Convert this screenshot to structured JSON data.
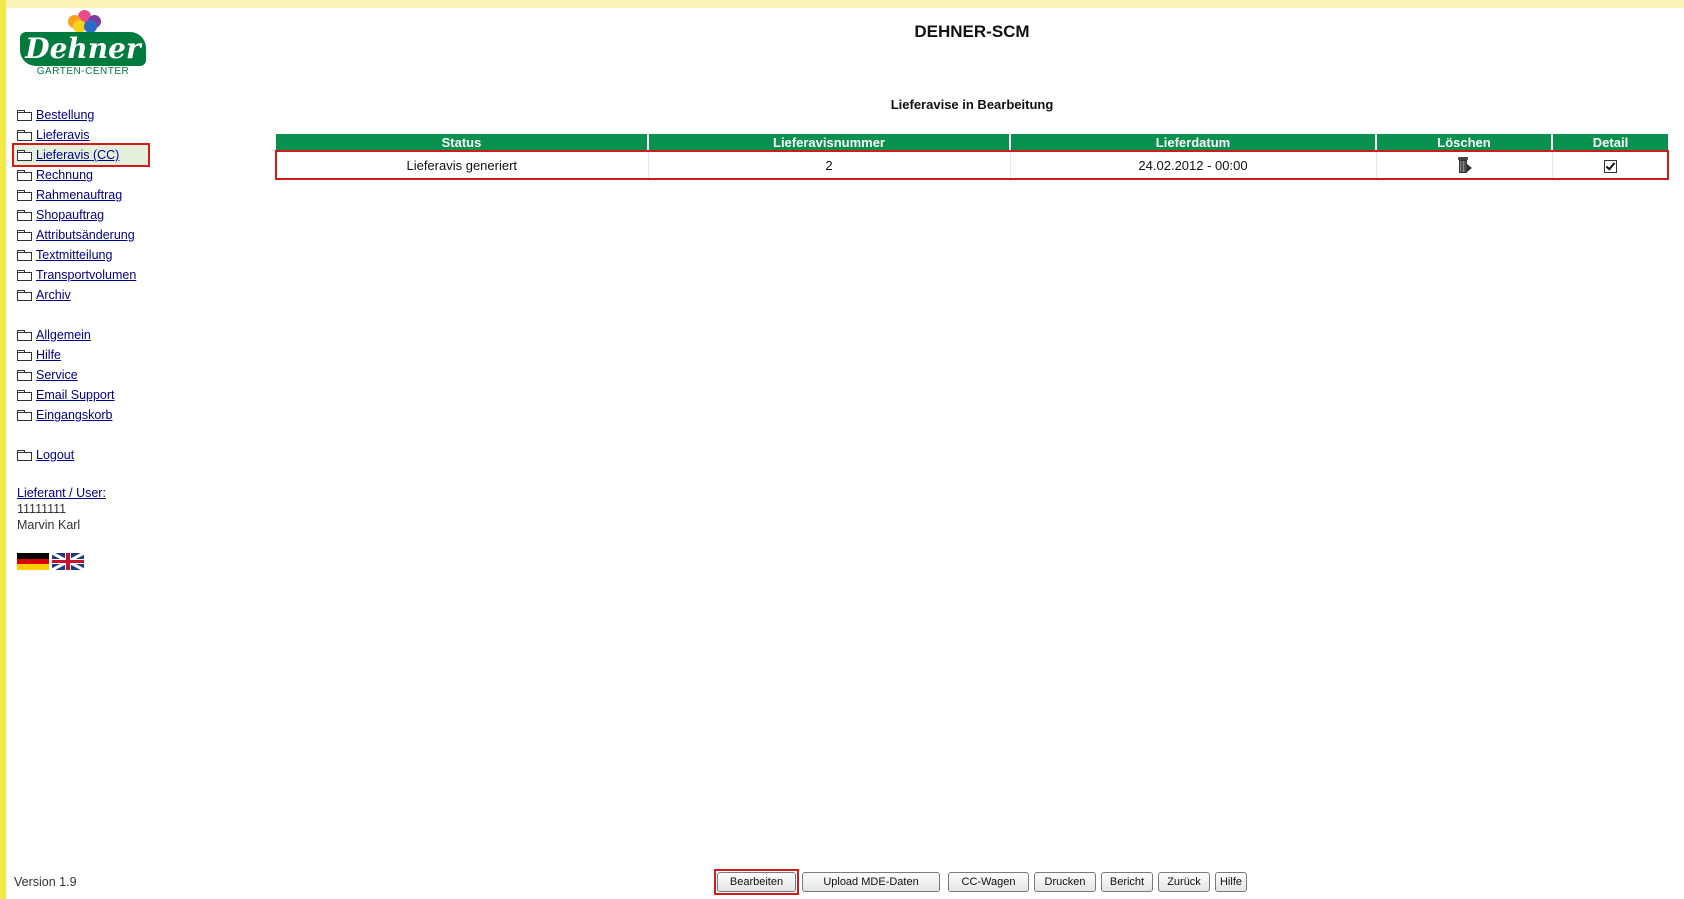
{
  "app": {
    "title": "DEHNER-SCM"
  },
  "logo": {
    "brand": "Dehner",
    "subtitle": "GARTEN-CENTER"
  },
  "sidebar": {
    "groups": [
      {
        "items": [
          {
            "label": "Bestellung"
          },
          {
            "label": "Lieferavis"
          },
          {
            "label": "Lieferavis (CC)",
            "active": true
          },
          {
            "label": "Rechnung"
          },
          {
            "label": "Rahmenauftrag"
          },
          {
            "label": "Shopauftrag"
          },
          {
            "label": "Attributsänderung"
          },
          {
            "label": "Textmitteilung"
          },
          {
            "label": "Transportvolumen"
          },
          {
            "label": "Archiv"
          }
        ]
      },
      {
        "items": [
          {
            "label": "Allgemein"
          },
          {
            "label": "Hilfe"
          },
          {
            "label": "Service"
          },
          {
            "label": "Email Support"
          },
          {
            "label": "Eingangskorb"
          }
        ]
      },
      {
        "items": [
          {
            "label": "Logout"
          }
        ]
      }
    ],
    "user": {
      "label": "Lieferant / User:",
      "id": "11111111",
      "name": "Marvin Karl"
    },
    "languages": [
      "de-flag-icon",
      "uk-flag-icon"
    ]
  },
  "main": {
    "section_title": "Lieferavise in Bearbeitung",
    "table": {
      "columns": [
        "Status",
        "Lieferavisnummer",
        "Lieferdatum",
        "Löschen",
        "Detail"
      ],
      "rows": [
        {
          "status": "Lieferavis generiert",
          "number": "2",
          "date": "24.02.2012 - 00:00",
          "delete_icon": "trash-icon",
          "detail_checked": true
        }
      ]
    }
  },
  "footer": {
    "version": "Version 1.9",
    "buttons": [
      "Bearbeiten",
      "Upload MDE-Daten",
      "CC-Wagen",
      "Drucken",
      "Bericht",
      "Zurück",
      "Hilfe"
    ]
  },
  "colors": {
    "header_green": "#0a9150",
    "brand_green": "#007a3d",
    "highlight_red": "#d11a1a",
    "link": "#00008b"
  }
}
